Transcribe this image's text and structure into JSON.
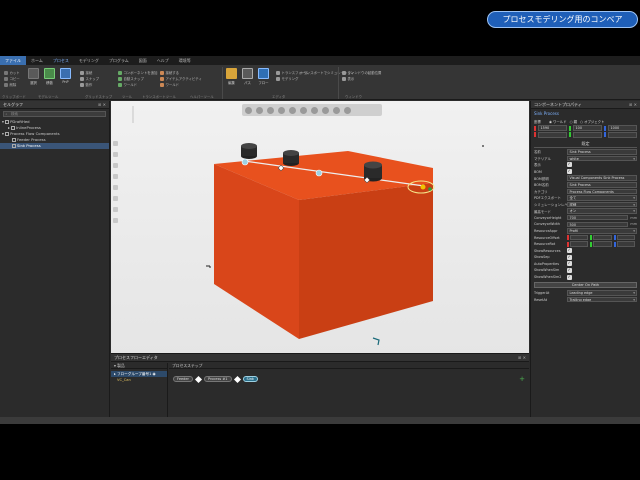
{
  "banner": "プロセスモデリング用のコンベア",
  "menu": {
    "tabs": [
      "ファイル",
      "ホーム",
      "プロセス",
      "モデリング",
      "プログラム",
      "図面",
      "ヘルプ",
      "環境等"
    ]
  },
  "ribbon": {
    "buttons": [
      "選択",
      "移動",
      "PnP"
    ],
    "small_items": [
      "接続",
      "スナップ",
      "動作",
      "コンポーネントを追加",
      "自動スナップ",
      "ワールド",
      "接続する",
      "アイテムアクティビティ",
      "ワールド"
    ],
    "right_items": [
      "トランスフォーム",
      "トランスポートでシミュレーション",
      "モデリング"
    ],
    "window_items": [
      "ウィンドウの起動位置",
      "表示"
    ],
    "groups": [
      "クリップボード",
      "モデルツール",
      "グリッドスナップ",
      "ツール",
      "トランスポートツール",
      "ヘルパーツール",
      "エディタ",
      "ウィンドウ"
    ]
  },
  "left_panel": {
    "title": "セルグラフ",
    "search_placeholder": "検索",
    "tree": [
      {
        "label": "PDraftHed",
        "indent": 0
      },
      {
        "label": "InlineProcess",
        "indent": 1
      },
      {
        "label": "Process Flow Components",
        "indent": 0
      },
      {
        "label": "Feeder Process",
        "indent": 2
      },
      {
        "label": "Sink Process",
        "indent": 2,
        "selected": true
      }
    ]
  },
  "viewport": {
    "nav_labels": [
      "L",
      "T",
      "R",
      "F"
    ]
  },
  "right_panel": {
    "title": "コンポーネントプロパティ",
    "component": "Sink Process",
    "coords_label": "座標",
    "coord_modes": [
      "ワールド",
      "親",
      "オブジェクト"
    ],
    "xyz": [
      "1590",
      "100",
      "1000"
    ],
    "section": "既定",
    "properties": [
      {
        "label": "名前",
        "value": "Sink Process",
        "type": "text"
      },
      {
        "label": "マテリアル",
        "value": "white",
        "type": "dropdown"
      },
      {
        "label": "表示",
        "value": "",
        "type": "check"
      },
      {
        "label": "BOM",
        "value": "",
        "type": "check"
      },
      {
        "label": "BOM説明",
        "value": "Visual Components Sink Process",
        "type": "text"
      },
      {
        "label": "BOM名前",
        "value": "Sink Process",
        "type": "text"
      },
      {
        "label": "カテゴリ",
        "value": "Process Flow Components",
        "type": "text"
      },
      {
        "label": "PDFエクスポート",
        "value": "全て",
        "type": "dropdown"
      },
      {
        "label": "シミュレーションレベル",
        "value": "詳細",
        "type": "dropdown"
      },
      {
        "label": "最高モード",
        "value": "オン",
        "type": "dropdown"
      },
      {
        "label": "ConveyorHeight",
        "value": "700",
        "unit": "mm",
        "type": "text"
      },
      {
        "label": "ConveyorWidth",
        "value": "500",
        "unit": "mm",
        "type": "text"
      },
      {
        "label": "ResourceAppr",
        "value": "Profil",
        "type": "dropdown"
      },
      {
        "label": "ResourceOffset",
        "value": "",
        "type": "xyz"
      },
      {
        "label": "ResourceRot",
        "value": "",
        "type": "xyz"
      },
      {
        "label": "ShowResources",
        "value": "",
        "type": "check"
      },
      {
        "label": "ShowSep",
        "value": "",
        "type": "check"
      },
      {
        "label": "AutoProperties",
        "value": "",
        "type": "check"
      },
      {
        "label": "ShowWhenSim",
        "value": "",
        "type": "check"
      },
      {
        "label": "ShowWhenSim2",
        "value": "",
        "type": "check"
      }
    ],
    "center_button": "Center On Path",
    "trigger_rows": [
      {
        "label": "TriggerAt",
        "value": "Leading edge"
      },
      {
        "label": "ResetAt",
        "value": "Trailing edge"
      }
    ]
  },
  "bottom_panel": {
    "title": "プロセスフローエディタ",
    "col_product": "製品",
    "col_process": "プロセスステップ",
    "group_row": "フローグループ番号1",
    "product_row": "VC_Can",
    "flow_steps": [
      "Feeder",
      "Process #1",
      "Sink"
    ]
  }
}
